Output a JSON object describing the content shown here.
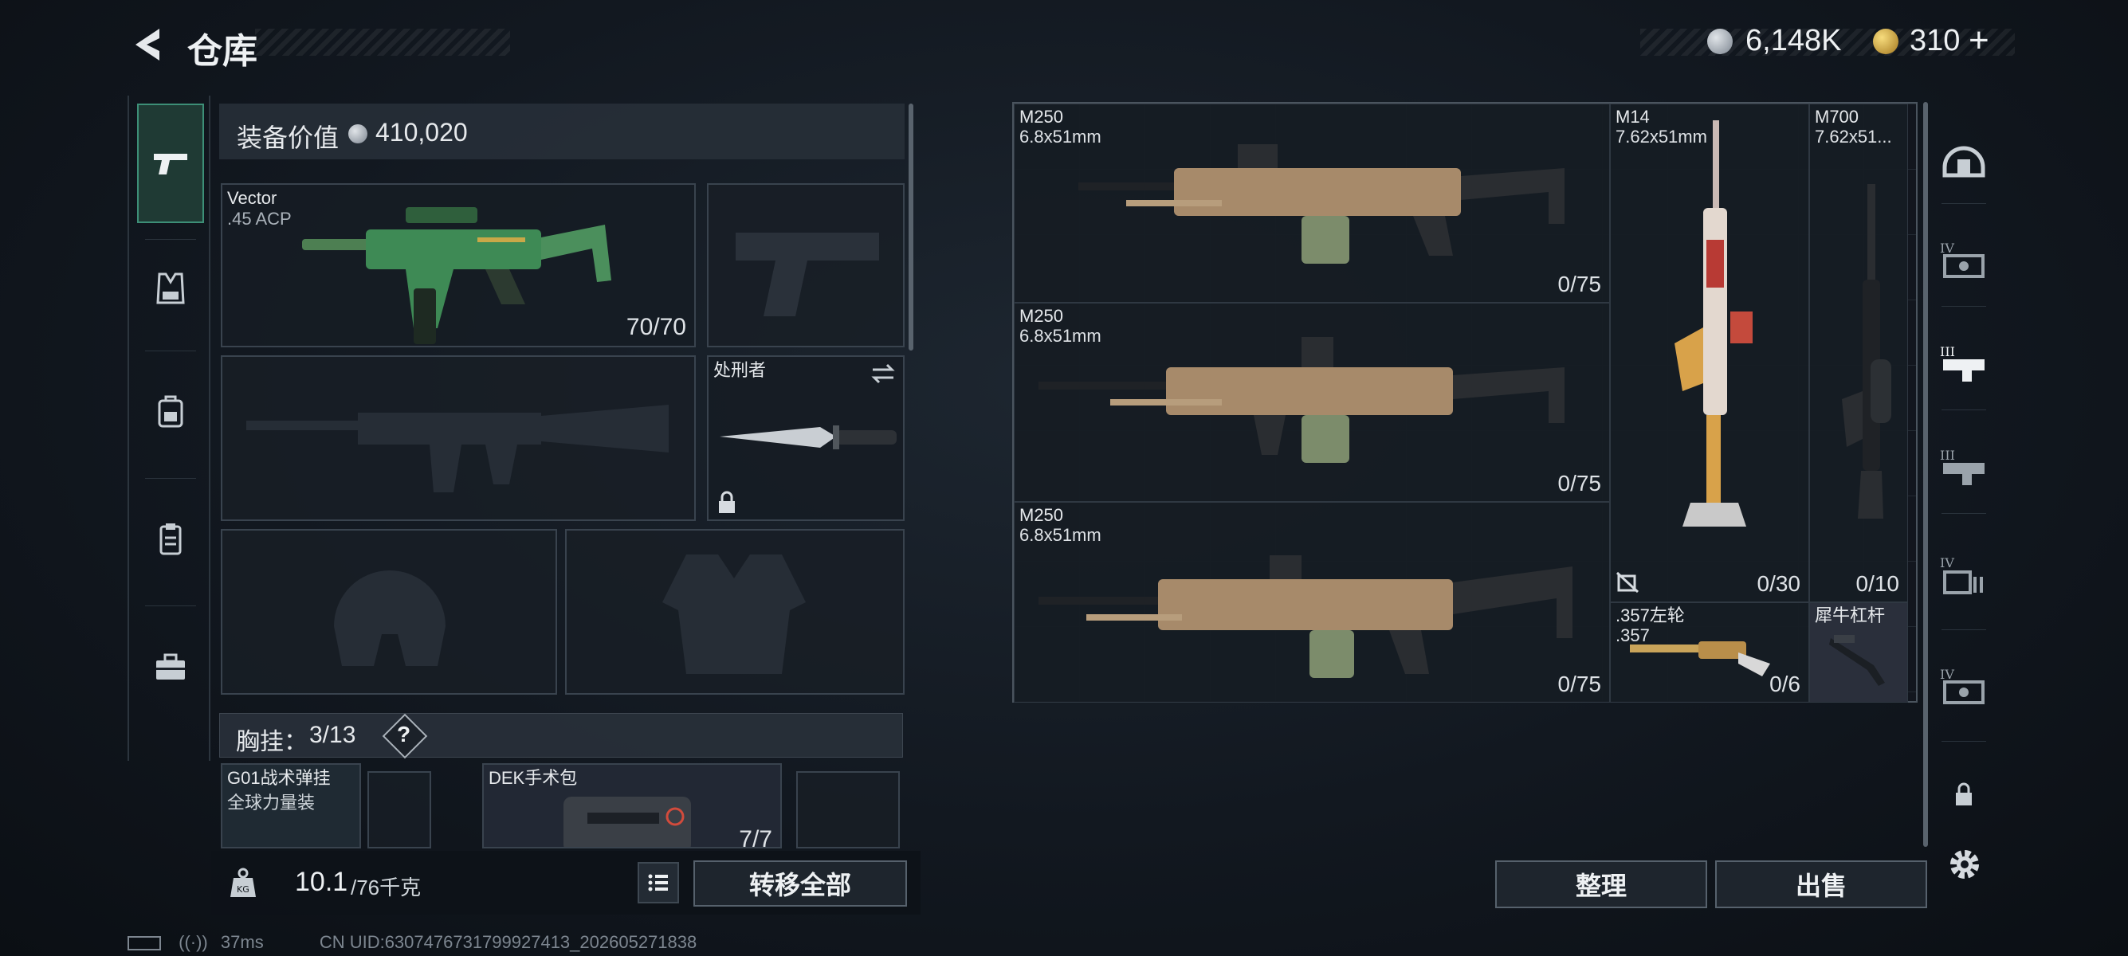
{
  "header": {
    "title": "仓库",
    "currency_silver": "6,148K",
    "currency_gold": "310",
    "plus_label": "+"
  },
  "left_tabs": [
    "pistol-icon",
    "vest-icon",
    "backpack-icon",
    "clipboard-icon",
    "briefcase-icon"
  ],
  "equipment": {
    "value_label": "装备价值",
    "value": "410,020",
    "primary": {
      "name": "Vector",
      "caliber": ".45 ACP",
      "count": "70/70"
    },
    "melee": {
      "name": "处刑者"
    },
    "chest_label": "胸挂：",
    "chest_count": "3/13",
    "help_label": "?",
    "chest_items": [
      {
        "name": "G01战术弹挂",
        "sub": "全球力量装"
      },
      {
        "name": "DEK手术包",
        "count": "7/7"
      }
    ]
  },
  "bottom_left": {
    "weight": "10.1",
    "weight_max": "/76千克",
    "transfer_label": "转移全部"
  },
  "status_bar": {
    "ping": "37ms",
    "uid": "CN UID:6307476731799927413_202605271838"
  },
  "storage": {
    "items": [
      {
        "name": "M250",
        "caliber": "6.8x51mm",
        "count": "0/75"
      },
      {
        "name": "M250",
        "caliber": "6.8x51mm",
        "count": "0/75"
      },
      {
        "name": "M250",
        "caliber": "6.8x51mm",
        "count": "0/75"
      },
      {
        "name": "M14",
        "caliber": "7.62x51mm",
        "count": "0/30"
      },
      {
        "name": "M700",
        "caliber": "7.62x51...",
        "count": "0/10"
      },
      {
        "name": ".357左轮",
        "caliber": ".357",
        "count": "0/6"
      },
      {
        "name": "犀牛杠杆",
        "caliber": ""
      }
    ]
  },
  "right_tabs": [
    "helmet-icon",
    "rack-iv-icon",
    "rack-iii-icon",
    "rack-iii-b-icon",
    "rack-iv-b-icon",
    "rack-iv-c-icon",
    "lock-icon"
  ],
  "buttons": {
    "sort_label": "整理",
    "sell_label": "出售"
  },
  "colors": {
    "accent_green": "#3d8f77",
    "gold": "#d9b24a",
    "silver": "#b8c0c8"
  }
}
